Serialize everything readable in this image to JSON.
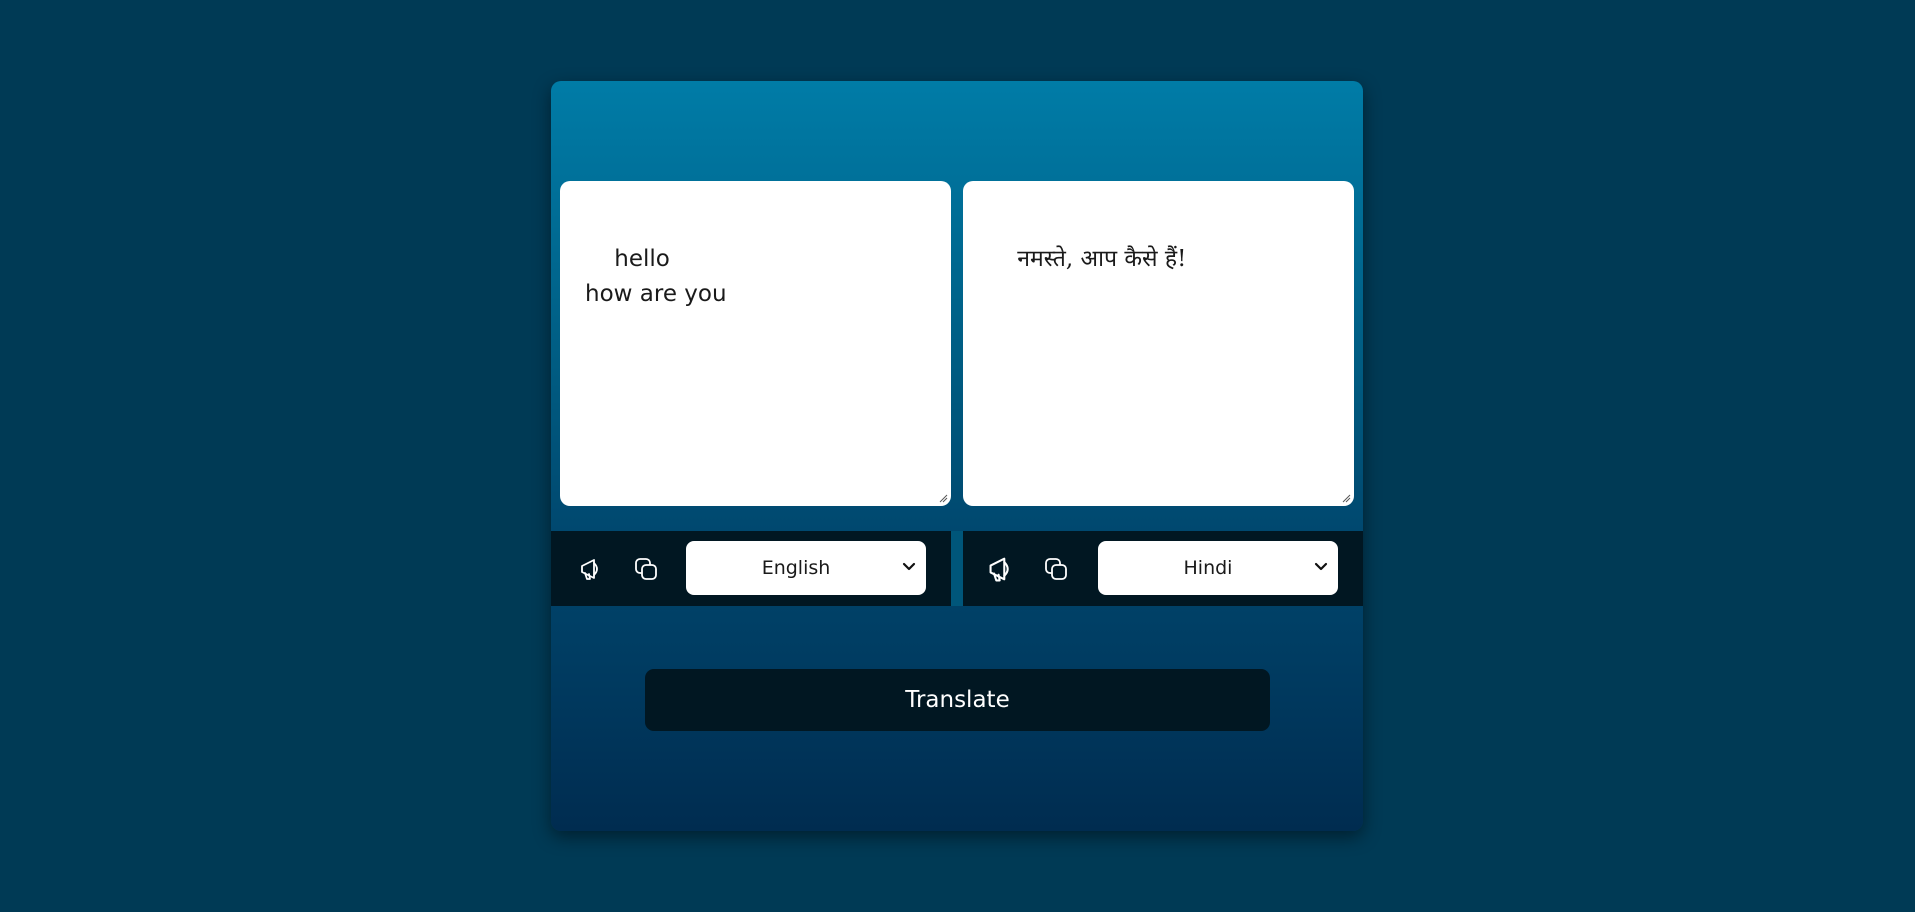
{
  "source": {
    "text": "hello\nhow are you",
    "language": "English",
    "speak_icon": "megaphone-icon",
    "copy_icon": "copy-icon"
  },
  "target": {
    "text": "नमस्ते, आप कैसे हैं!",
    "language": "Hindi",
    "speak_icon": "megaphone-icon",
    "copy_icon": "copy-icon"
  },
  "translate_button": {
    "label": "Translate"
  },
  "colors": {
    "background": "#003a55",
    "card_top": "#007ca7",
    "card_bottom": "#002c50",
    "toolbar": "#011722",
    "button": "#011722"
  }
}
